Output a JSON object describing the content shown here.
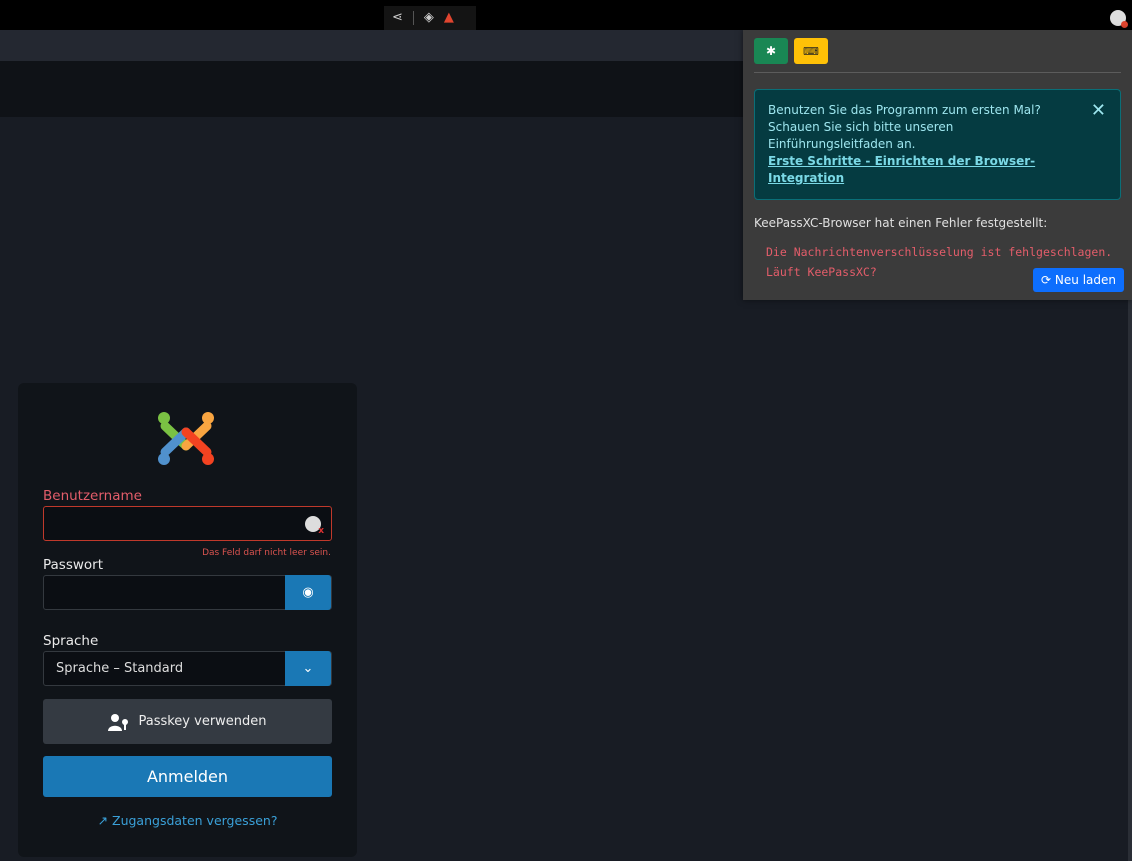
{
  "popup": {
    "info_text": "Benutzen Sie das Programm zum ersten Mal? Schauen Sie sich bitte unseren Einführungsleitfaden an.",
    "info_link": "Erste Schritte - Einrichten der Browser-Integration",
    "info_close": "✕",
    "error_title": "KeePassXC-Browser hat einen Fehler festgestellt:",
    "error_line1": "Die Nachrichtenverschlüsselung ist fehlgeschlagen.",
    "error_line2": "Läuft KeePassXC?",
    "reload_label": "Neu laden",
    "reload_icon": "⟳"
  },
  "login": {
    "username_label": "Benutzername",
    "username_value": "",
    "username_error": "Das Feld darf nicht leer sein.",
    "password_label": "Passwort",
    "password_value": "",
    "language_label": "Sprache",
    "language_selected": "Sprache – Standard",
    "passkey_label": "Passkey verwenden",
    "login_label": "Anmelden",
    "forgot_label": "Zugangsdaten vergessen?",
    "forgot_icon": "↗"
  },
  "colors": {
    "primary": "#1a78b5",
    "error": "#e35d6a",
    "info_bg": "#053b41",
    "success": "#198754",
    "warning": "#ffc107"
  }
}
